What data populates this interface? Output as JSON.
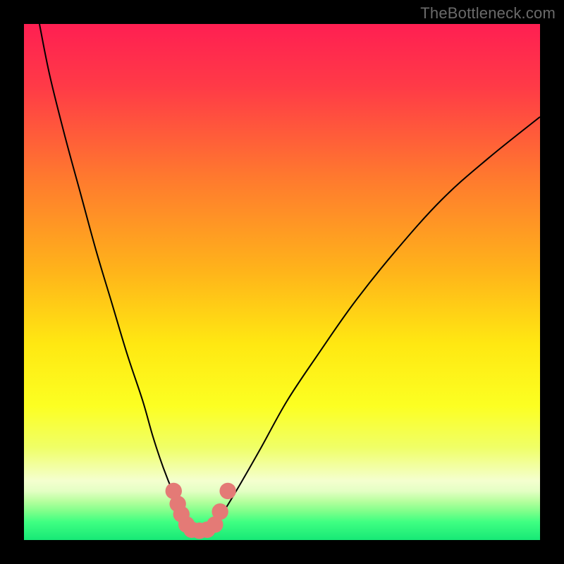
{
  "attribution": "TheBottleneck.com",
  "colors": {
    "frame": "#000000",
    "curve": "#000000",
    "marker": "#e47a76",
    "gradient_stops": [
      {
        "offset": 0.0,
        "color": "#ff1f52"
      },
      {
        "offset": 0.12,
        "color": "#ff3a47"
      },
      {
        "offset": 0.3,
        "color": "#ff7a2e"
      },
      {
        "offset": 0.48,
        "color": "#ffb41a"
      },
      {
        "offset": 0.62,
        "color": "#ffe812"
      },
      {
        "offset": 0.74,
        "color": "#fcff22"
      },
      {
        "offset": 0.82,
        "color": "#f0ff66"
      },
      {
        "offset": 0.885,
        "color": "#f4ffcf"
      },
      {
        "offset": 0.905,
        "color": "#e4ffc4"
      },
      {
        "offset": 0.925,
        "color": "#b6ff9e"
      },
      {
        "offset": 0.945,
        "color": "#7dff8a"
      },
      {
        "offset": 0.965,
        "color": "#3fff82"
      },
      {
        "offset": 1.0,
        "color": "#17e876"
      }
    ]
  },
  "chart_data": {
    "type": "line",
    "title": "",
    "xlabel": "",
    "ylabel": "",
    "xlim": [
      0,
      100
    ],
    "ylim": [
      0,
      100
    ],
    "grid": false,
    "legend": false,
    "series": [
      {
        "name": "bottleneck-curve",
        "x": [
          3,
          5,
          8,
          11,
          14,
          17,
          20,
          23,
          25,
          27,
          29,
          30.5,
          32,
          33.5,
          35,
          37,
          39,
          42,
          46,
          51,
          57,
          64,
          72,
          81,
          90,
          100
        ],
        "y": [
          100,
          90,
          78,
          67,
          56,
          46,
          36,
          27,
          20,
          14,
          9,
          6,
          3.5,
          2,
          2,
          3,
          6,
          11,
          18,
          27,
          36,
          46,
          56,
          66,
          74,
          82
        ]
      }
    ],
    "markers": {
      "name": "optimal-zone-markers",
      "points": [
        {
          "x": 29.0,
          "y": 9.5
        },
        {
          "x": 29.8,
          "y": 7.0
        },
        {
          "x": 30.5,
          "y": 5.0
        },
        {
          "x": 31.5,
          "y": 3.0
        },
        {
          "x": 32.5,
          "y": 2.0
        },
        {
          "x": 34.0,
          "y": 1.8
        },
        {
          "x": 35.5,
          "y": 2.0
        },
        {
          "x": 37.0,
          "y": 3.0
        },
        {
          "x": 38.0,
          "y": 5.5
        },
        {
          "x": 39.5,
          "y": 9.5
        }
      ],
      "radius_pct": 1.6
    }
  }
}
